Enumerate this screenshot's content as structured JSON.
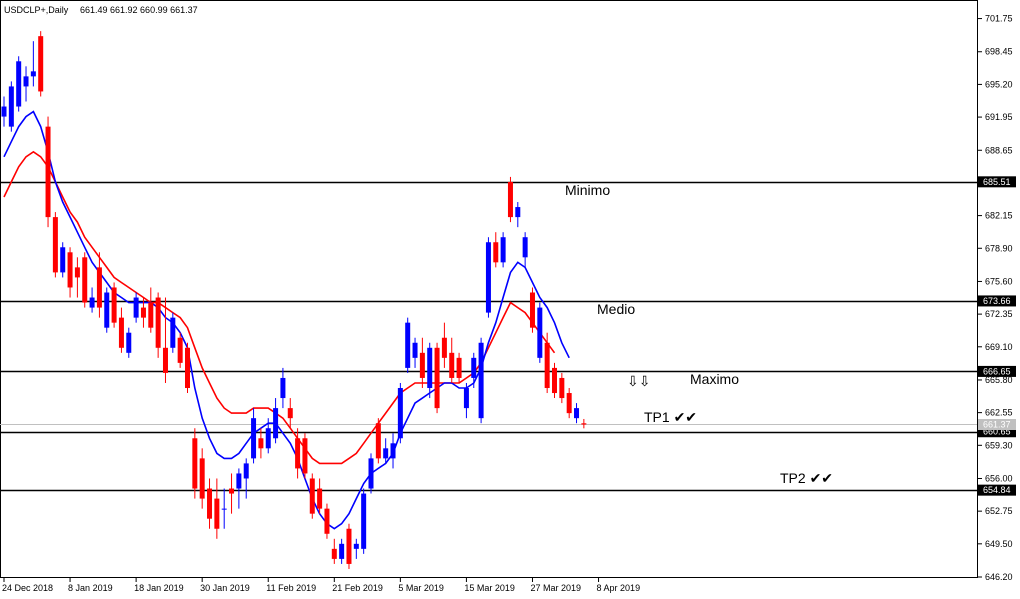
{
  "header": {
    "symbol": "USDCLP+,Daily",
    "ohlc": "661.49 661.92 660.99 661.37"
  },
  "colors": {
    "bull": "#0000ff",
    "bear": "#ff0000",
    "ma_fast": "#0000ff",
    "ma_slow": "#ff0000",
    "level_line": "#000000",
    "current_price_line": "#c0c0c0"
  },
  "chart_data": {
    "type": "candlestick",
    "ylim": [
      646.2,
      703.0
    ],
    "y_ticks": [
      "701.75",
      "698.45",
      "695.20",
      "691.95",
      "688.65",
      "682.15",
      "678.90",
      "675.60",
      "672.35",
      "669.10",
      "665.80",
      "662.55",
      "659.30",
      "656.00",
      "652.75",
      "649.50",
      "646.20"
    ],
    "x_ticks": [
      "24 Dec 2018",
      "8 Jan 2019",
      "18 Jan 2019",
      "30 Jan 2019",
      "11 Feb 2019",
      "21 Feb 2019",
      "5 Mar 2019",
      "15 Mar 2019",
      "27 Mar 2019",
      "8 Apr 2019"
    ],
    "x_tick_index": [
      0,
      9,
      18,
      27,
      36,
      45,
      54,
      63,
      72,
      81
    ],
    "current_price": "661.37",
    "levels": [
      {
        "price": 685.51,
        "label": "685.51",
        "name": "Minimo"
      },
      {
        "price": 673.66,
        "label": "673.66",
        "name": "Medio"
      },
      {
        "price": 666.65,
        "label": "666.65",
        "name": "Maximo"
      },
      {
        "price": 660.65,
        "label": "660.65",
        "name": "TP1"
      },
      {
        "price": 654.84,
        "label": "654.84",
        "name": "TP2"
      }
    ],
    "annotations": {
      "minimo": "Minimo",
      "medio": "Medio",
      "maximo": "Maximo",
      "tp1": "TP1 ✔✔",
      "tp2": "TP2 ✔✔",
      "arrows": "⇩⇩"
    },
    "candles": [
      {
        "o": 692.0,
        "h": 694.0,
        "l": 691.0,
        "c": 693.0
      },
      {
        "o": 691.0,
        "h": 695.5,
        "l": 690.5,
        "c": 695.0
      },
      {
        "o": 693.0,
        "h": 698.0,
        "l": 692.5,
        "c": 697.5
      },
      {
        "o": 695.0,
        "h": 697.0,
        "l": 693.5,
        "c": 696.0
      },
      {
        "o": 696.0,
        "h": 699.5,
        "l": 695.0,
        "c": 696.5
      },
      {
        "o": 700.0,
        "h": 700.5,
        "l": 694.0,
        "c": 694.5
      },
      {
        "o": 691.0,
        "h": 692.0,
        "l": 681.0,
        "c": 682.0
      },
      {
        "o": 682.0,
        "h": 682.5,
        "l": 676.0,
        "c": 676.5
      },
      {
        "o": 676.5,
        "h": 679.5,
        "l": 676.0,
        "c": 679.0
      },
      {
        "o": 678.5,
        "h": 679.0,
        "l": 674.0,
        "c": 675.0
      },
      {
        "o": 677.0,
        "h": 678.0,
        "l": 674.0,
        "c": 676.0
      },
      {
        "o": 678.0,
        "h": 678.5,
        "l": 673.0,
        "c": 673.5
      },
      {
        "o": 673.0,
        "h": 675.0,
        "l": 672.5,
        "c": 674.0
      },
      {
        "o": 677.0,
        "h": 678.5,
        "l": 672.0,
        "c": 673.0
      },
      {
        "o": 671.0,
        "h": 675.0,
        "l": 670.5,
        "c": 674.5
      },
      {
        "o": 675.0,
        "h": 675.5,
        "l": 671.0,
        "c": 671.5
      },
      {
        "o": 672.0,
        "h": 673.0,
        "l": 668.5,
        "c": 669.0
      },
      {
        "o": 668.5,
        "h": 671.0,
        "l": 668.0,
        "c": 670.5
      },
      {
        "o": 672.0,
        "h": 674.5,
        "l": 671.5,
        "c": 674.0
      },
      {
        "o": 673.0,
        "h": 674.0,
        "l": 671.0,
        "c": 672.0
      },
      {
        "o": 673.5,
        "h": 675.0,
        "l": 670.5,
        "c": 671.0
      },
      {
        "o": 674.0,
        "h": 674.5,
        "l": 668.0,
        "c": 669.0
      },
      {
        "o": 669.0,
        "h": 674.0,
        "l": 665.5,
        "c": 666.5
      },
      {
        "o": 669.0,
        "h": 672.5,
        "l": 668.5,
        "c": 672.0
      },
      {
        "o": 670.0,
        "h": 670.5,
        "l": 667.0,
        "c": 667.5
      },
      {
        "o": 669.0,
        "h": 669.5,
        "l": 664.5,
        "c": 665.0
      },
      {
        "o": 660.0,
        "h": 661.0,
        "l": 654.0,
        "c": 655.0
      },
      {
        "o": 658.0,
        "h": 659.0,
        "l": 653.0,
        "c": 654.0
      },
      {
        "o": 655.0,
        "h": 656.0,
        "l": 651.0,
        "c": 652.0
      },
      {
        "o": 654.0,
        "h": 656.0,
        "l": 650.0,
        "c": 651.0
      },
      {
        "o": 653.0,
        "h": 655.0,
        "l": 651.0,
        "c": 653.0
      },
      {
        "o": 655.0,
        "h": 656.5,
        "l": 652.5,
        "c": 654.5
      },
      {
        "o": 655.0,
        "h": 657.0,
        "l": 653.0,
        "c": 656.5
      },
      {
        "o": 656.0,
        "h": 658.0,
        "l": 654.0,
        "c": 657.5
      },
      {
        "o": 658.0,
        "h": 663.0,
        "l": 657.5,
        "c": 662.0
      },
      {
        "o": 660.0,
        "h": 661.0,
        "l": 658.0,
        "c": 659.0
      },
      {
        "o": 659.0,
        "h": 662.0,
        "l": 658.5,
        "c": 661.0
      },
      {
        "o": 660.0,
        "h": 664.0,
        "l": 659.5,
        "c": 663.0
      },
      {
        "o": 664.0,
        "h": 667.0,
        "l": 663.0,
        "c": 666.0
      },
      {
        "o": 663.0,
        "h": 664.0,
        "l": 661.0,
        "c": 662.0
      },
      {
        "o": 660.0,
        "h": 661.0,
        "l": 656.0,
        "c": 657.0
      },
      {
        "o": 660.0,
        "h": 660.5,
        "l": 656.0,
        "c": 656.5
      },
      {
        "o": 656.0,
        "h": 656.5,
        "l": 652.0,
        "c": 652.5
      },
      {
        "o": 655.0,
        "h": 656.0,
        "l": 652.5,
        "c": 653.0
      },
      {
        "o": 653.0,
        "h": 653.5,
        "l": 650.0,
        "c": 650.5
      },
      {
        "o": 649.0,
        "h": 650.0,
        "l": 647.5,
        "c": 648.0
      },
      {
        "o": 648.0,
        "h": 650.0,
        "l": 647.5,
        "c": 649.5
      },
      {
        "o": 651.0,
        "h": 651.5,
        "l": 647.0,
        "c": 647.5
      },
      {
        "o": 649.0,
        "h": 650.0,
        "l": 648.0,
        "c": 649.5
      },
      {
        "o": 649.0,
        "h": 655.0,
        "l": 648.5,
        "c": 654.5
      },
      {
        "o": 655.0,
        "h": 658.5,
        "l": 654.5,
        "c": 658.0
      },
      {
        "o": 661.5,
        "h": 662.0,
        "l": 657.5,
        "c": 658.0
      },
      {
        "o": 658.0,
        "h": 660.0,
        "l": 657.5,
        "c": 659.0
      },
      {
        "o": 658.0,
        "h": 660.5,
        "l": 657.0,
        "c": 659.5
      },
      {
        "o": 660.0,
        "h": 665.5,
        "l": 659.5,
        "c": 665.0
      },
      {
        "o": 667.0,
        "h": 672.0,
        "l": 666.5,
        "c": 671.5
      },
      {
        "o": 668.0,
        "h": 670.0,
        "l": 667.0,
        "c": 669.5
      },
      {
        "o": 668.5,
        "h": 670.0,
        "l": 665.0,
        "c": 666.0
      },
      {
        "o": 665.0,
        "h": 669.5,
        "l": 664.0,
        "c": 669.0
      },
      {
        "o": 669.0,
        "h": 669.5,
        "l": 662.5,
        "c": 663.0
      },
      {
        "o": 670.0,
        "h": 671.5,
        "l": 667.0,
        "c": 668.0
      },
      {
        "o": 668.5,
        "h": 670.0,
        "l": 665.5,
        "c": 666.0
      },
      {
        "o": 668.0,
        "h": 668.5,
        "l": 665.5,
        "c": 666.0
      },
      {
        "o": 663.0,
        "h": 665.5,
        "l": 662.0,
        "c": 665.0
      },
      {
        "o": 666.0,
        "h": 668.5,
        "l": 665.0,
        "c": 668.0
      },
      {
        "o": 662.0,
        "h": 670.0,
        "l": 661.5,
        "c": 669.5
      },
      {
        "o": 672.5,
        "h": 680.0,
        "l": 672.0,
        "c": 679.5
      },
      {
        "o": 679.5,
        "h": 680.5,
        "l": 677.0,
        "c": 677.5
      },
      {
        "o": 677.5,
        "h": 680.5,
        "l": 677.0,
        "c": 680.0
      },
      {
        "o": 685.5,
        "h": 686.0,
        "l": 681.5,
        "c": 682.0
      },
      {
        "o": 682.0,
        "h": 683.5,
        "l": 681.0,
        "c": 683.0
      },
      {
        "o": 678.0,
        "h": 680.5,
        "l": 677.0,
        "c": 680.0
      },
      {
        "o": 674.5,
        "h": 675.0,
        "l": 670.5,
        "c": 671.0
      },
      {
        "o": 668.0,
        "h": 673.5,
        "l": 667.5,
        "c": 673.0
      },
      {
        "o": 669.5,
        "h": 670.5,
        "l": 664.5,
        "c": 665.0
      },
      {
        "o": 667.0,
        "h": 667.5,
        "l": 664.0,
        "c": 664.5
      },
      {
        "o": 666.0,
        "h": 666.5,
        "l": 663.5,
        "c": 664.0
      },
      {
        "o": 664.5,
        "h": 665.0,
        "l": 662.0,
        "c": 662.5
      },
      {
        "o": 662.0,
        "h": 663.5,
        "l": 661.5,
        "c": 663.0
      },
      {
        "o": 661.49,
        "h": 661.92,
        "l": 660.99,
        "c": 661.37
      }
    ],
    "ma_fast": [
      688.0,
      689.5,
      691.0,
      692.0,
      692.5,
      691.0,
      688.5,
      685.5,
      683.5,
      682.0,
      680.5,
      679.0,
      677.5,
      676.5,
      675.5,
      674.5,
      674.0,
      673.5,
      673.5,
      673.5,
      673.5,
      673.0,
      672.0,
      671.5,
      670.5,
      669.0,
      665.0,
      662.0,
      660.0,
      658.5,
      658.0,
      658.0,
      658.5,
      659.5,
      660.5,
      661.0,
      661.5,
      661.5,
      660.5,
      659.5,
      658.0,
      656.0,
      654.0,
      652.5,
      651.5,
      651.0,
      651.5,
      652.5,
      654.0,
      655.5,
      656.5,
      657.0,
      657.5,
      658.5,
      660.5,
      662.0,
      663.5,
      664.0,
      664.5,
      665.0,
      665.5,
      665.5,
      665.0,
      665.0,
      665.5,
      667.0,
      669.5,
      671.5,
      674.0,
      676.5,
      677.5,
      677.0,
      675.5,
      674.0,
      673.0,
      671.5,
      669.5,
      668.0
    ],
    "ma_slow": [
      684.0,
      685.5,
      687.0,
      688.0,
      688.5,
      688.0,
      687.0,
      685.5,
      684.0,
      682.5,
      681.5,
      680.0,
      679.0,
      678.0,
      677.0,
      676.0,
      675.5,
      675.0,
      674.5,
      674.0,
      673.5,
      673.5,
      673.0,
      672.5,
      672.0,
      671.0,
      669.0,
      667.0,
      665.5,
      664.0,
      663.0,
      662.5,
      662.5,
      662.5,
      663.0,
      663.0,
      663.0,
      662.5,
      662.0,
      661.0,
      660.0,
      659.0,
      658.0,
      657.5,
      657.5,
      657.5,
      657.5,
      658.0,
      658.5,
      659.5,
      660.5,
      661.5,
      662.5,
      663.5,
      664.5,
      665.0,
      665.5,
      665.5,
      665.5,
      665.5,
      665.5,
      665.5,
      665.5,
      666.0,
      666.5,
      667.5,
      669.0,
      670.5,
      672.0,
      673.5,
      673.0,
      672.5,
      671.5,
      670.5,
      669.5,
      668.5
    ]
  }
}
